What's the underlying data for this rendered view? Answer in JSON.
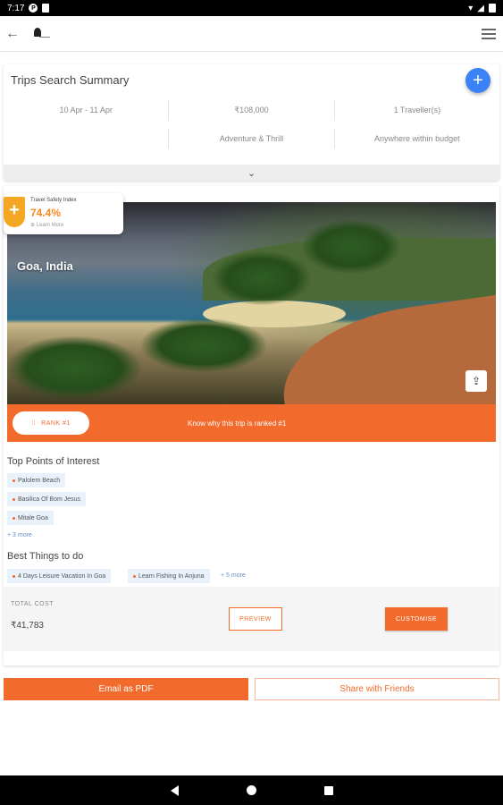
{
  "status": {
    "time": "7:17",
    "app_icon": "P"
  },
  "header": {
    "back_glyph": "←",
    "logo_name": "app-logo"
  },
  "summary": {
    "title": "Trips  Search Summary",
    "add_glyph": "+",
    "row1": [
      "10 Apr - 11 Apr",
      "₹108,000",
      "1 Traveller(s)"
    ],
    "row2": [
      "",
      "Adventure & Thrill",
      "Anywhere within budget"
    ],
    "expand_glyph": "⌄"
  },
  "trip": {
    "safety_label": "Travel Safety Index",
    "safety_value": "74.4%",
    "safety_more": "⊕ Learn More",
    "shield_glyph": "+",
    "destination": "Goa, India",
    "share_glyph": "⇪",
    "rank_label": "RANK #1",
    "rank_icon": "⁞⁞",
    "rank_reason": "Know why this trip is ranked #1",
    "poi_title": "Top Points of Interest",
    "poi": [
      "Palolem Beach",
      "Basilica Of Bom Jesus",
      "Mitale Goa"
    ],
    "poi_more": "+ 3 more",
    "things_title": "Best Things to do",
    "things": [
      "4 Days Leisure Vacation In Goa",
      "Learn Fishing In Anjuna"
    ],
    "things_more": "+ 5 more",
    "cost_label": "TOTAL COST",
    "cost_value": "₹41,783",
    "preview_label": "PREVIEW",
    "customise_label": "CUSTOMISE"
  },
  "actions": {
    "email": "Email as PDF",
    "share": "Share with Friends"
  },
  "colors": {
    "accent": "#f26b2c",
    "fab": "#3b82f6",
    "safety": "#f5a623"
  }
}
